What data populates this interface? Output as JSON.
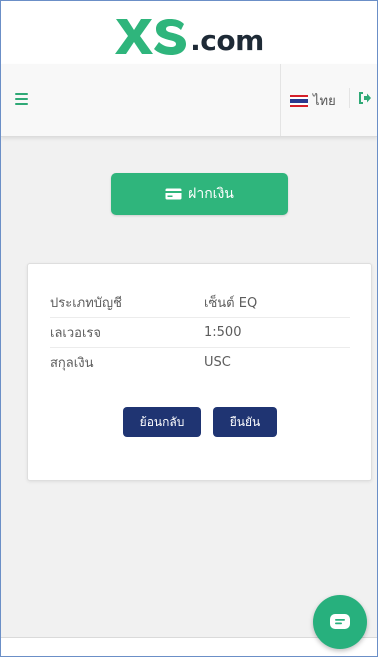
{
  "header": {
    "logo_text": "XS.com",
    "logo_dot_com": ".com"
  },
  "nav": {
    "menu_icon": "hamburger-icon",
    "language_label": "ไทย",
    "flag_icon": "thai-flag-icon",
    "logout_icon": "logout-icon"
  },
  "deposit_button": {
    "label": "ฝากเงิน",
    "icon": "credit-card-icon"
  },
  "summary": {
    "rows": [
      {
        "label": "ประเภทบัญชี",
        "value": "เซ็นต์ EQ"
      },
      {
        "label": "เลเวอเรจ",
        "value": "1:500"
      },
      {
        "label": "สกุลเงิน",
        "value": "USC"
      }
    ],
    "back_label": "ย้อนกลับ",
    "confirm_label": "ยืนยัน"
  },
  "chat": {
    "icon": "chat-bubble-icon"
  },
  "colors": {
    "brand_green": "#2fb57c",
    "button_navy": "#1f3472",
    "logo_dark": "#1e2a36"
  }
}
